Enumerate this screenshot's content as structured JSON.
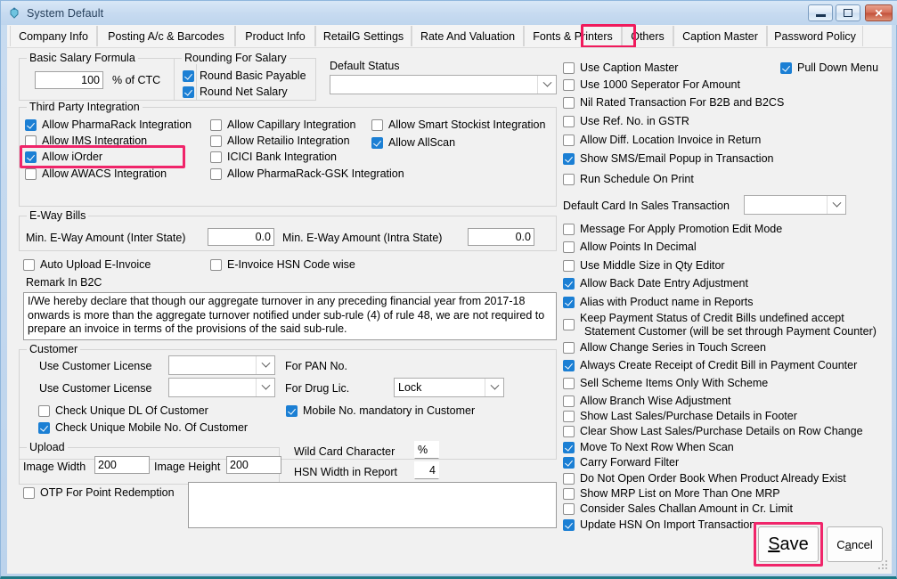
{
  "window": {
    "title": "System Default",
    "icon": "app-icon",
    "buttons": {
      "minimize": "minimize-icon",
      "maximize": "maximize-icon",
      "close": "close-icon"
    }
  },
  "tabs": [
    {
      "label": "Company Info",
      "selected": false
    },
    {
      "label": "Posting A/c & Barcodes",
      "selected": false
    },
    {
      "label": "Product Info",
      "selected": false
    },
    {
      "label": "RetailG Settings",
      "selected": false
    },
    {
      "label": "Rate And Valuation",
      "selected": false
    },
    {
      "label": "Fonts & Printers",
      "selected": false
    },
    {
      "label": "Others",
      "selected": true
    },
    {
      "label": "Caption Master",
      "selected": false
    },
    {
      "label": "Password Policy",
      "selected": false
    }
  ],
  "highlight_color": "#f0256a",
  "left": {
    "basic_salary": {
      "legend": "Basic Salary Formula",
      "value": "100",
      "suffix": "% of CTC"
    },
    "rounding": {
      "legend": "Rounding For Salary",
      "items": [
        {
          "label": "Round Basic Payable",
          "checked": true
        },
        {
          "label": "Round Net Salary",
          "checked": true
        }
      ]
    },
    "default_status": {
      "label": "Default Status",
      "value": ""
    },
    "third_party": {
      "legend": "Third Party Integration",
      "col1": [
        {
          "label": "Allow PharmaRack Integration",
          "checked": true
        },
        {
          "label": "Allow IMS Integration",
          "checked": false
        },
        {
          "label": "Allow iOrder",
          "checked": true,
          "highlighted": true
        },
        {
          "label": "Allow AWACS Integration",
          "checked": false
        }
      ],
      "col2": [
        {
          "label": "Allow Capillary Integration",
          "checked": false
        },
        {
          "label": "Allow Retailio Integration",
          "checked": false
        },
        {
          "label": "ICICI Bank Integration",
          "checked": false
        },
        {
          "label": "Allow PharmaRack-GSK Integration",
          "checked": false
        }
      ],
      "col3": [
        {
          "label": "Allow Smart Stockist Integration",
          "checked": false
        },
        {
          "label": "Allow AllScan",
          "checked": true
        }
      ]
    },
    "eway": {
      "legend": "E-Way Bills",
      "inter_label": "Min. E-Way Amount (Inter State)",
      "inter_value": "0.0",
      "intra_label": "Min. E-Way Amount (Intra State)",
      "intra_value": "0.0"
    },
    "einvoice": [
      {
        "label": "Auto Upload E-Invoice",
        "checked": false
      },
      {
        "label": "E-Invoice HSN Code wise",
        "checked": false
      }
    ],
    "remark": {
      "label": "Remark In B2C",
      "text": "I/We hereby declare that though our aggregate turnover in any preceding financial year from 2017-18 onwards is more than the aggregate turnover notified under sub-rule (4) of rule 48, we are not required to prepare an invoice in terms of the provisions of the said sub-rule."
    },
    "customer": {
      "legend": "Customer",
      "row1": {
        "label": "Use Customer License",
        "value": "",
        "suffix": "For PAN No."
      },
      "row2": {
        "label": "Use Customer License",
        "value": "",
        "suffix": "For Drug Lic.",
        "lock_value": "Lock"
      },
      "checks": [
        {
          "label": "Check Unique DL Of Customer",
          "checked": false
        },
        {
          "label": "Mobile No. mandatory in Customer",
          "checked": true
        },
        {
          "label": "Check Unique Mobile No. Of Customer",
          "checked": true
        }
      ]
    },
    "upload": {
      "legend": "Upload",
      "width_label": "Image Width",
      "width_value": "200",
      "height_label": "Image Height",
      "height_value": "200"
    },
    "wildcard": {
      "label": "Wild Card Character",
      "value": "%"
    },
    "hsn_width": {
      "label": "HSN Width in Report",
      "value": "4"
    },
    "otp": {
      "label": "OTP For Point Redemption",
      "checked": false
    },
    "otp_memo": ""
  },
  "right": {
    "pull_down_menu": {
      "label": "Pull Down Menu",
      "checked": true
    },
    "options_top": [
      {
        "label": "Use Caption Master",
        "checked": false
      },
      {
        "label": "Use 1000 Seperator For Amount",
        "checked": false
      },
      {
        "label": "Nil Rated Transaction For B2B and B2CS",
        "checked": false
      },
      {
        "label": "Use Ref. No. in GSTR",
        "checked": false
      },
      {
        "label": "Allow Diff. Location Invoice in Return",
        "checked": false
      },
      {
        "label": "Show SMS/Email Popup in Transaction",
        "checked": true
      },
      {
        "label": "Run Schedule On Print",
        "checked": false
      }
    ],
    "default_card": {
      "label": "Default Card In Sales Transaction",
      "value": ""
    },
    "options_mid": [
      {
        "label": "Message For Apply Promotion Edit Mode",
        "checked": false
      },
      {
        "label": "Allow Points In Decimal",
        "checked": false
      },
      {
        "label": "Use Middle Size in Qty Editor",
        "checked": false
      },
      {
        "label": "Allow Back Date Entry Adjustment",
        "checked": true
      },
      {
        "label": "Alias with Product name in Reports",
        "checked": true
      }
    ],
    "keep_payment": {
      "line1": "Keep Payment Status of Credit Bills undefined accept",
      "line2": "Statement Customer (will be set through Payment Counter)",
      "checked": false
    },
    "options_bottom": [
      {
        "label": "Allow Change Series in Touch Screen",
        "checked": false
      },
      {
        "label": "Always Create Receipt of Credit Bill in Payment Counter",
        "checked": true
      },
      {
        "label": "Sell Scheme Items Only With Scheme",
        "checked": false
      },
      {
        "label": "Allow Branch Wise Adjustment",
        "checked": false
      },
      {
        "label": "Show Last Sales/Purchase Details in Footer",
        "checked": false
      },
      {
        "label": "Clear Show Last Sales/Purchase Details on Row Change",
        "checked": false
      },
      {
        "label": "Move To Next Row When Scan",
        "checked": true
      },
      {
        "label": "Carry Forward Filter",
        "checked": true
      },
      {
        "label": "Do Not Open Order Book When Product Already Exist",
        "checked": false
      },
      {
        "label": "Show MRP List on More Than One MRP",
        "checked": false
      },
      {
        "label": "Consider Sales Challan Amount in Cr. Limit",
        "checked": false
      },
      {
        "label": "Update HSN On Import Transaction",
        "checked": true
      }
    ]
  },
  "footer": {
    "save": {
      "prefix": "S",
      "rest": "ave",
      "highlighted": true
    },
    "cancel": {
      "pre": "C",
      "mid": "a",
      "post": "ncel"
    }
  }
}
